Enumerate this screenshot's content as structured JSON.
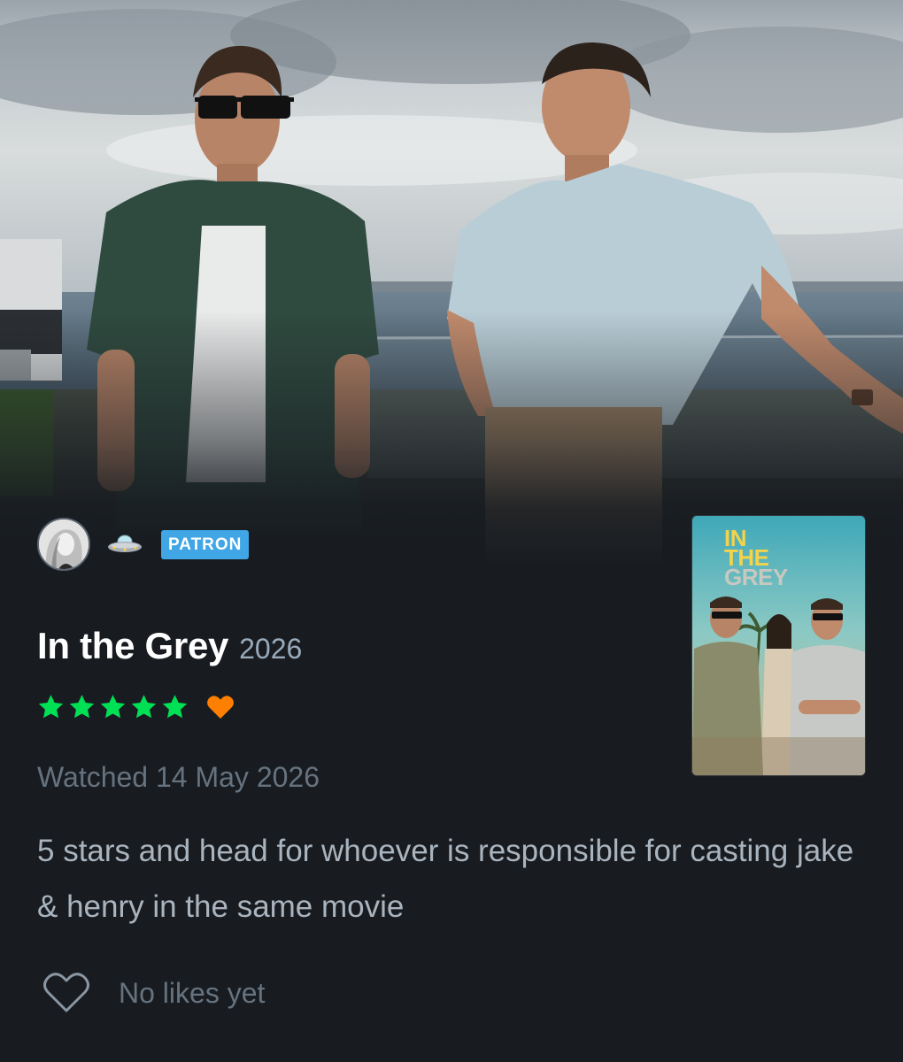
{
  "review": {
    "reviewer": {
      "avatar": "avatar",
      "badge_icon": "ufo-icon",
      "badge_label": "PATRON"
    },
    "film": {
      "title": "In the Grey",
      "year": "2026",
      "poster_title_lines": [
        "IN",
        "THE",
        "GREY"
      ]
    },
    "rating": {
      "stars": 5,
      "max_stars": 5,
      "liked": true,
      "star_color": "#00e054",
      "heart_color": "#ff8000"
    },
    "watched_label": "Watched 14 May 2026",
    "body": "5 stars and head for whoever is responsible for casting jake & henry in the same movie",
    "likes": {
      "icon": "heart-outline-icon",
      "label": "No likes yet"
    }
  },
  "colors": {
    "background": "#181c21",
    "patron_badge": "#40a6e6",
    "muted_text": "#66737f",
    "body_text": "#aab4be"
  }
}
